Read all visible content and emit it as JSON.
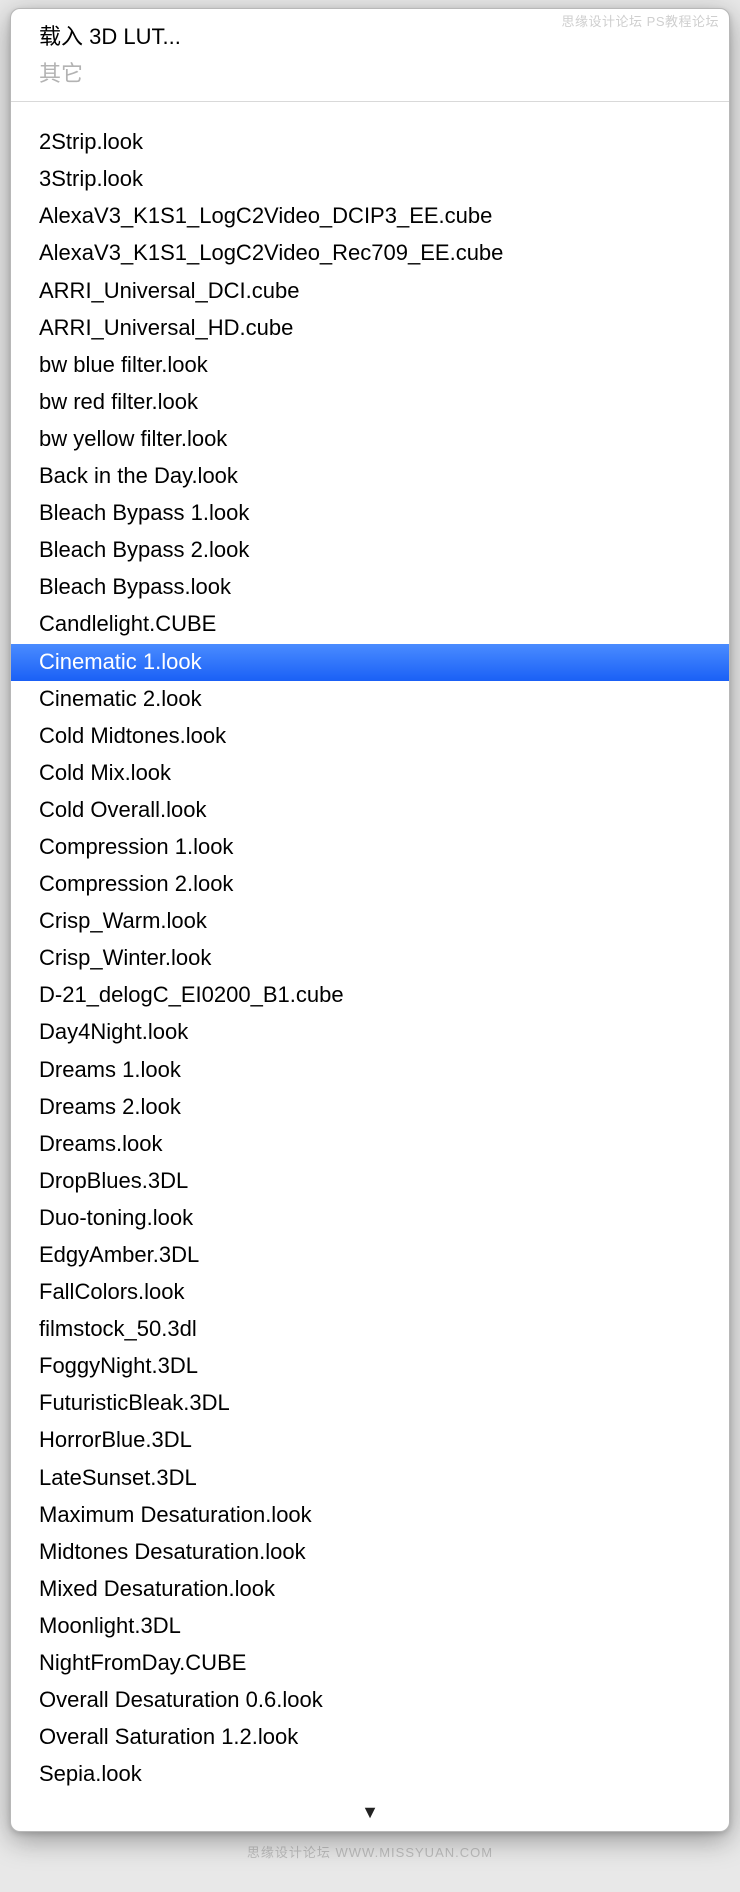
{
  "watermark_top": "思缘设计论坛  PS教程论坛",
  "watermark_bottom": "思缘设计论坛  WWW.MISSYUAN.COM",
  "header": {
    "load_lut_label": "载入 3D LUT...",
    "other_label": "其它"
  },
  "selected_index": 14,
  "items": [
    "2Strip.look",
    "3Strip.look",
    "AlexaV3_K1S1_LogC2Video_DCIP3_EE.cube",
    "AlexaV3_K1S1_LogC2Video_Rec709_EE.cube",
    "ARRI_Universal_DCI.cube",
    "ARRI_Universal_HD.cube",
    "bw blue filter.look",
    "bw red filter.look",
    "bw yellow filter.look",
    "Back in the Day.look",
    "Bleach Bypass 1.look",
    "Bleach Bypass 2.look",
    "Bleach Bypass.look",
    "Candlelight.CUBE",
    "Cinematic 1.look",
    "Cinematic 2.look",
    "Cold Midtones.look",
    "Cold Mix.look",
    "Cold Overall.look",
    "Compression 1.look",
    "Compression 2.look",
    "Crisp_Warm.look",
    "Crisp_Winter.look",
    "D-21_delogC_EI0200_B1.cube",
    "Day4Night.look",
    "Dreams 1.look",
    "Dreams 2.look",
    "Dreams.look",
    "DropBlues.3DL",
    "Duo-toning.look",
    "EdgyAmber.3DL",
    "FallColors.look",
    "filmstock_50.3dl",
    "FoggyNight.3DL",
    "FuturisticBleak.3DL",
    "HorrorBlue.3DL",
    "LateSunset.3DL",
    "Maximum Desaturation.look",
    "Midtones Desaturation.look",
    "Mixed Desaturation.look",
    "Moonlight.3DL",
    "NightFromDay.CUBE",
    "Overall Desaturation 0.6.look",
    "Overall Saturation 1.2.look",
    "Sepia.look"
  ],
  "scroll_indicator": "▼"
}
